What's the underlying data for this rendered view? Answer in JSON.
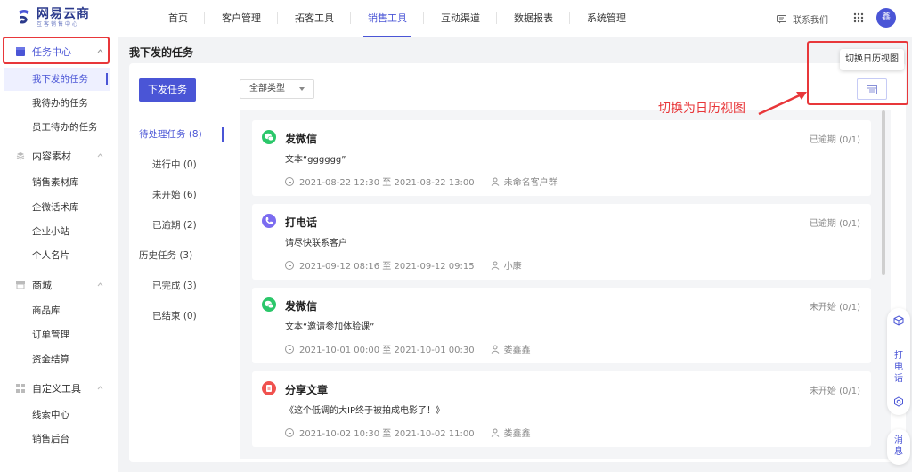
{
  "brand": {
    "name": "网易云商",
    "subtitle": "互客销售中心"
  },
  "nav": {
    "items": [
      "首页",
      "客户管理",
      "拓客工具",
      "销售工具",
      "互动渠道",
      "数据报表",
      "系统管理"
    ],
    "active": "销售工具"
  },
  "header": {
    "contact": "联系我们",
    "avatar": "鑫"
  },
  "sidebar": {
    "groups": [
      {
        "label": "任务中心",
        "items": [
          "我下发的任务",
          "我待办的任务",
          "员工待办的任务"
        ]
      },
      {
        "label": "内容素材",
        "items": [
          "销售素材库",
          "企微话术库",
          "企业小站",
          "个人名片"
        ]
      },
      {
        "label": "商城",
        "items": [
          "商品库",
          "订单管理",
          "资金结算"
        ]
      },
      {
        "label": "自定义工具",
        "items": [
          "线索中心",
          "销售后台"
        ]
      }
    ],
    "active_item": "我下发的任务"
  },
  "page": {
    "title": "我下发的任务"
  },
  "left_panel": {
    "issue_button": "下发任务",
    "pending": "待处理任务 (8)",
    "pending_sub": [
      "进行中 (0)",
      "未开始 (6)",
      "已逾期 (2)"
    ],
    "history": "历史任务 (3)",
    "history_sub": [
      "已完成 (3)",
      "已结束 (0)"
    ]
  },
  "filter": {
    "type_select": "全部类型"
  },
  "calendar_tooltip": "切换日历视图",
  "annotation": "切换为日历视图",
  "tasks": [
    {
      "title": "发微信",
      "status": "已逾期 (0/1)",
      "desc": "文本“gggggg”",
      "time": "2021-08-22 12:30 至 2021-08-22 13:00",
      "target": "未命名客户群",
      "icon_color": "#2bc76a",
      "icon": "wechat-icon"
    },
    {
      "title": "打电话",
      "status": "已逾期 (0/1)",
      "desc": "请尽快联系客户",
      "time": "2021-09-12 08:16 至 2021-09-12 09:15",
      "target": "小康",
      "icon_color": "#7b6cf0",
      "icon": "phone-icon"
    },
    {
      "title": "发微信",
      "status": "未开始 (0/1)",
      "desc": "文本“邀请参加体验课”",
      "time": "2021-10-01 00:00 至 2021-10-01 00:30",
      "target": "娄鑫鑫",
      "icon_color": "#2bc76a",
      "icon": "wechat-icon"
    },
    {
      "title": "分享文章",
      "status": "未开始 (0/1)",
      "desc": "《这个低调的大IP终于被拍成电影了！》",
      "time": "2021-10-02 10:30 至 2021-10-02 11:00",
      "target": "娄鑫鑫",
      "icon_color": "#f0524f",
      "icon": "article-icon"
    }
  ],
  "float_bar": {
    "call": "打电话",
    "message": "消息"
  }
}
